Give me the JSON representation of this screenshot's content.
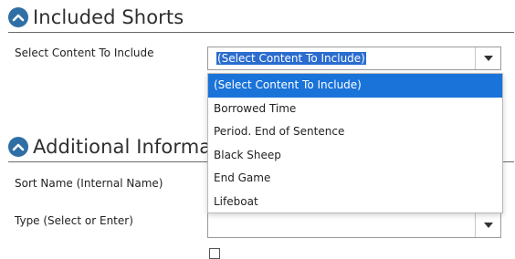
{
  "included_shorts": {
    "title": "Included Shorts",
    "select_label": "Select Content To Include",
    "select_value": "(Select Content To Include)",
    "dropdown_options": [
      "(Select Content To Include)",
      "Borrowed Time",
      "Period. End of Sentence",
      "Black Sheep",
      "End Game",
      "Lifeboat"
    ]
  },
  "additional_information": {
    "title": "Additional Informa",
    "sort_name_label": "Sort Name (Internal Name)",
    "type_label": "Type (Select or Enter)"
  },
  "colors": {
    "icon_blue": "#2f6fa5",
    "option_selected_bg": "#1a73d9",
    "value_highlight_bg": "#2a6ccf"
  }
}
